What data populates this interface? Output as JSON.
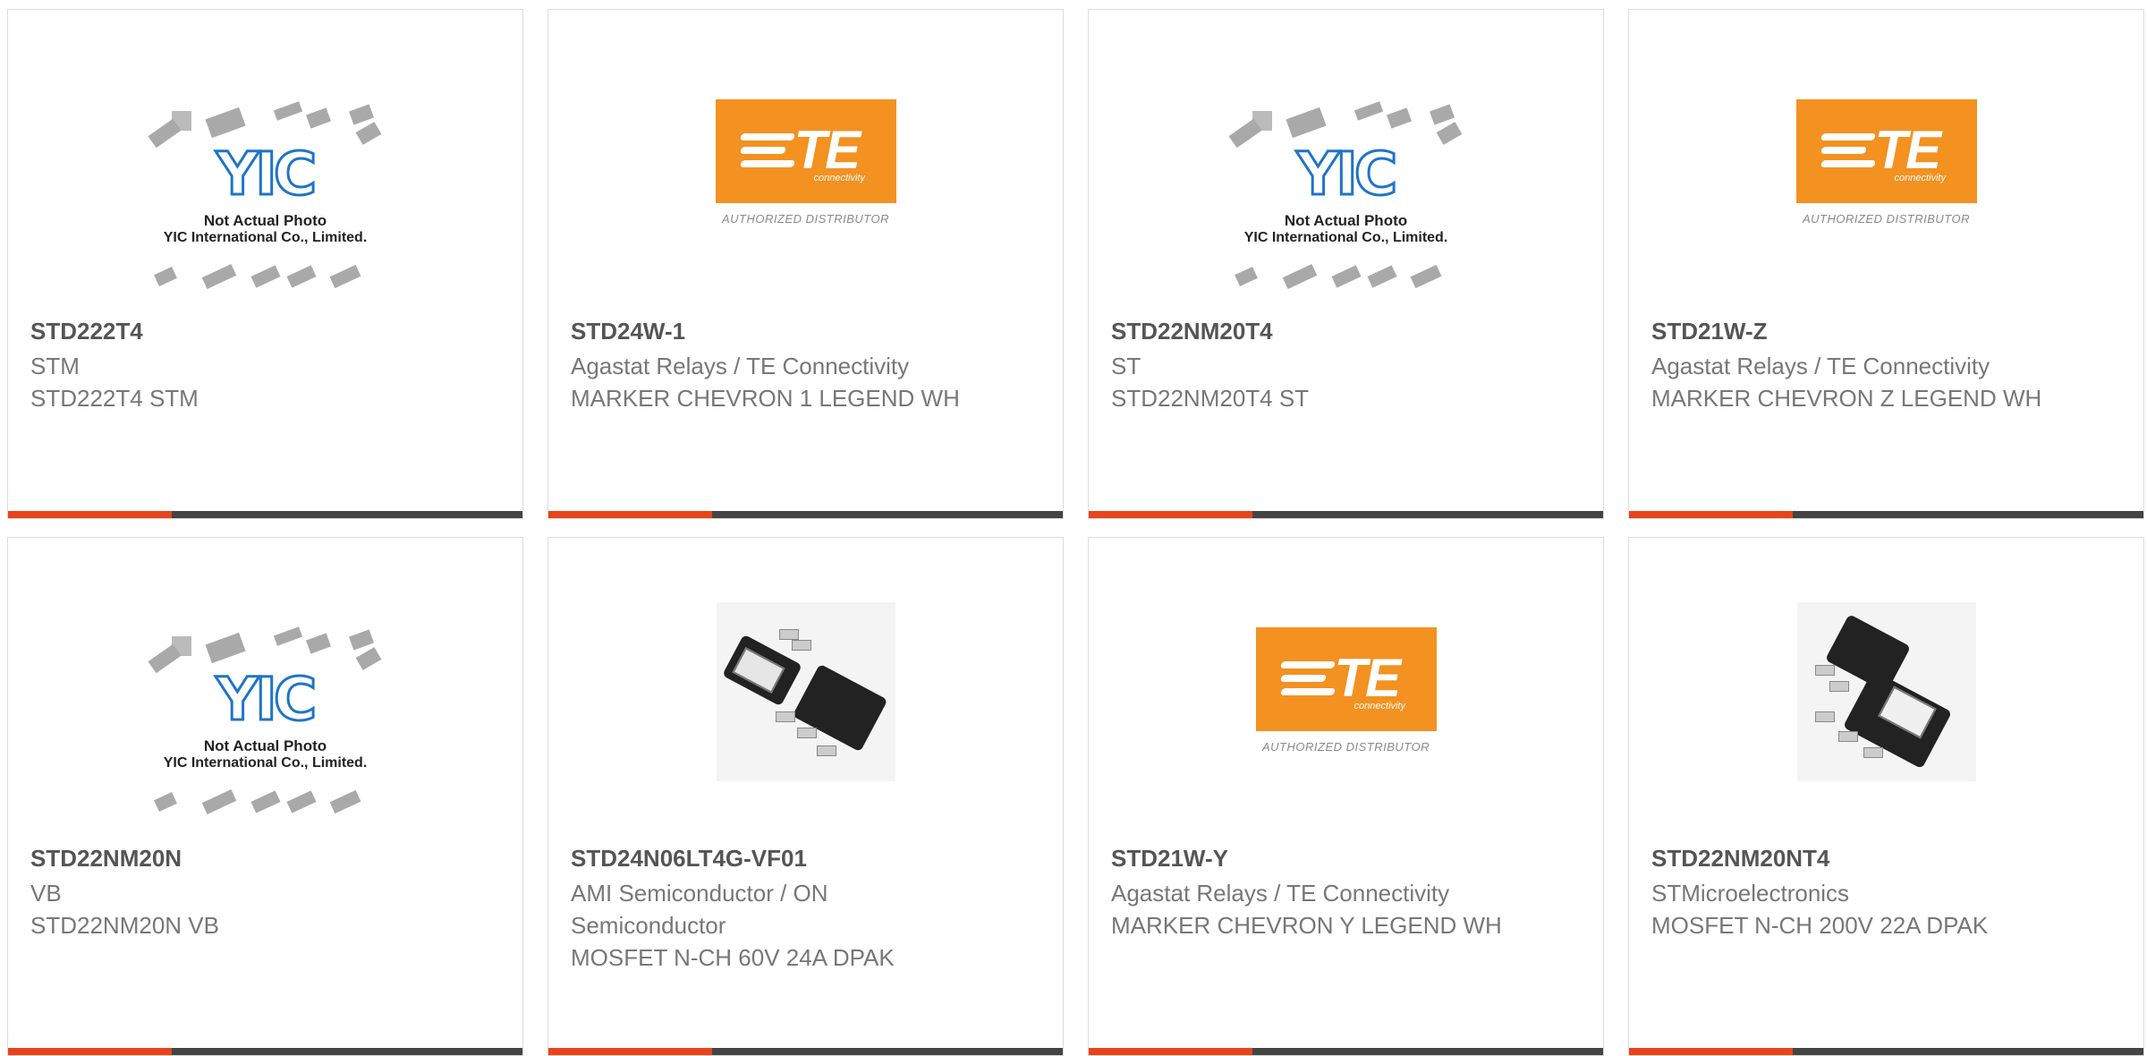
{
  "te_logo": {
    "mark": "TE",
    "sub": "connectivity",
    "authorized": "AUTHORIZED DISTRIBUTOR",
    "color": "#f39121"
  },
  "yic_placeholder": {
    "logo": "YIC",
    "caption_line1": "Not Actual Photo",
    "caption_line2": "YIC International Co., Limited."
  },
  "accent_color": "#e8441b",
  "products": [
    {
      "part_number": "STD222T4",
      "manufacturer": "STM",
      "description": "STD222T4 STM",
      "image": "yic-placeholder"
    },
    {
      "part_number": "STD24W-1",
      "manufacturer": "Agastat Relays / TE Connectivity",
      "description": "MARKER CHEVRON 1 LEGEND WH",
      "image": "te-logo"
    },
    {
      "part_number": "STD22NM20T4",
      "manufacturer": "ST",
      "description": "STD22NM20T4 ST",
      "image": "yic-placeholder"
    },
    {
      "part_number": "STD21W-Z",
      "manufacturer": "Agastat Relays / TE Connectivity",
      "description": "MARKER CHEVRON Z LEGEND WH",
      "image": "te-logo"
    },
    {
      "part_number": "STD22NM20N",
      "manufacturer": "VB",
      "description": "STD22NM20N VB",
      "image": "yic-placeholder"
    },
    {
      "part_number": "STD24N06LT4G-VF01",
      "manufacturer": "AMI Semiconductor / ON Semiconductor",
      "description": "MOSFET N-CH 60V 24A DPAK",
      "image": "dpak-photo"
    },
    {
      "part_number": "STD21W-Y",
      "manufacturer": "Agastat Relays / TE Connectivity",
      "description": "MARKER CHEVRON Y LEGEND WH",
      "image": "te-logo"
    },
    {
      "part_number": "STD22NM20NT4",
      "manufacturer": "STMicroelectronics",
      "description": "MOSFET N-CH 200V 22A DPAK",
      "image": "dpak-photo"
    }
  ]
}
